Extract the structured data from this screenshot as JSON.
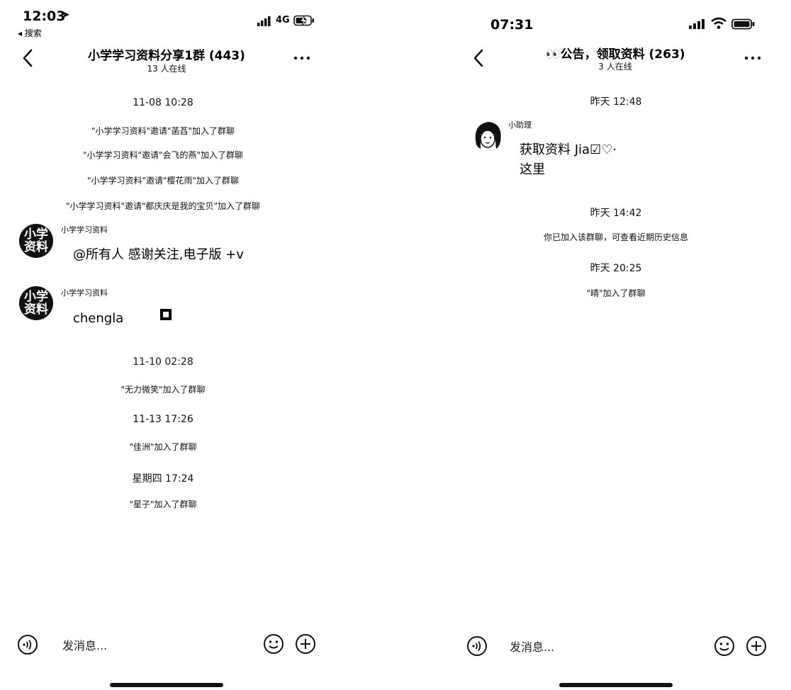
{
  "left": {
    "status": {
      "time": "12:03",
      "back_label": "◂ 搜索",
      "network": "4G"
    },
    "header": {
      "title": "小学学习资料分享1群 (443)",
      "online": "13 人在线"
    },
    "timeline": {
      "t1": "11-08 10:28",
      "sys1": "\"小学学习资料\"邀请\"菡萏\"加入了群聊",
      "sys2": "\"小学学习资料\"邀请\"会飞的燕\"加入了群聊",
      "sys3": "\"小学学习资料\"邀请\"樱花雨\"加入了群聊",
      "sys4": "\"小学学习资料\"邀请\"都庆庆是我的宝贝\"加入了群聊",
      "msg1": {
        "avatar": [
          "小学",
          "资料"
        ],
        "sender": "小学学习资料",
        "text": "@所有人 感谢关注,电子版 +v"
      },
      "msg2": {
        "avatar": [
          "小学",
          "资料"
        ],
        "sender": "小学学习资料",
        "text": "chengla"
      },
      "t2": "11-10 02:28",
      "sys5": "\"无力微笑\"加入了群聊",
      "t3": "11-13 17:26",
      "sys6": "\"佳洲\"加入了群聊",
      "t4": "星期四 17:24",
      "sys7": "\"星子\"加入了群聊"
    },
    "input": {
      "placeholder": "发消息..."
    }
  },
  "right": {
    "status": {
      "time": "07:31"
    },
    "header": {
      "title": "👀公告，领取资料 (263)",
      "online": "3 人在线"
    },
    "timeline": {
      "t1": "昨天 12:48",
      "msg1": {
        "sender": "小助理",
        "line1": "获取资料 Jia☑♡·",
        "line2": "这里"
      },
      "t2": "昨天 14:42",
      "sys1": "你已加入该群聊，可查看近期历史信息",
      "t3": "昨天 20:25",
      "sys2": "\"晴\"加入了群聊"
    },
    "input": {
      "placeholder": "发消息..."
    }
  }
}
